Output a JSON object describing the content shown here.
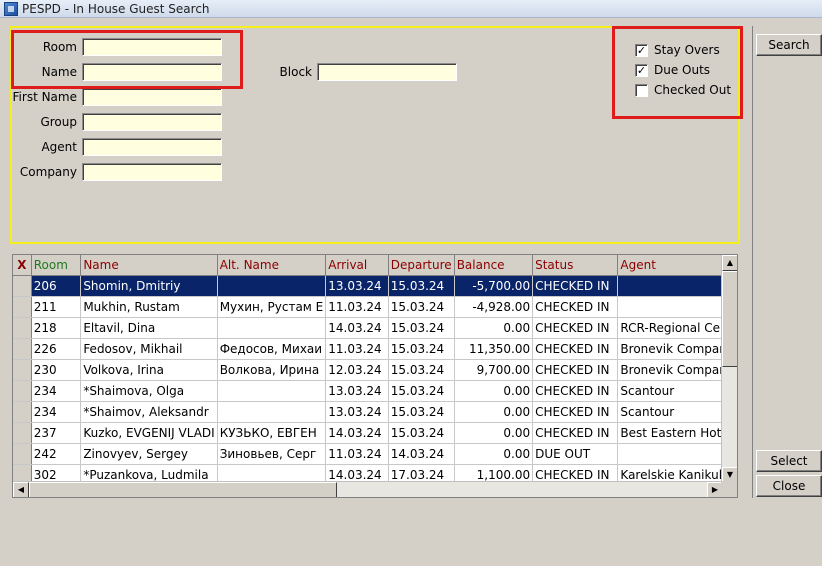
{
  "window": {
    "title": "PESPD - In House Guest Search"
  },
  "form": {
    "room_label": "Room",
    "name_label": "Name",
    "first_name_label": "First Name",
    "group_label": "Group",
    "agent_label": "Agent",
    "company_label": "Company",
    "block_label": "Block",
    "room_value": "",
    "name_value": "",
    "first_name_value": "",
    "group_value": "",
    "agent_value": "",
    "company_value": "",
    "block_value": ""
  },
  "filters": {
    "stay_overs": {
      "label": "Stay Overs",
      "checked": true
    },
    "due_outs": {
      "label": "Due Outs",
      "checked": true
    },
    "checked_out": {
      "label": "Checked Out",
      "checked": false
    }
  },
  "buttons": {
    "search": "Search",
    "select": "Select",
    "close": "Close"
  },
  "colors": {
    "highlight_box": "#e01b1b",
    "panel_border": "#f2f018",
    "selected_row": "#0a246a",
    "field_bg": "#ffffe0"
  },
  "grid": {
    "columns": [
      "X",
      "Room",
      "Name",
      "Alt. Name",
      "Arrival",
      "Departure",
      "Balance",
      "Status",
      "Agent"
    ],
    "rows": [
      [
        "",
        "206",
        "Shomin, Dmitriy",
        "",
        "13.03.24",
        "15.03.24",
        "-5,700.00",
        "CHECKED IN",
        ""
      ],
      [
        "",
        "211",
        "Mukhin, Rustam",
        "Мухин, Рустам Е",
        "11.03.24",
        "15.03.24",
        "-4,928.00",
        "CHECKED IN",
        ""
      ],
      [
        "",
        "218",
        "Eltavil, Dina",
        "",
        "14.03.24",
        "15.03.24",
        "0.00",
        "CHECKED IN",
        "RCR-Regional Cen"
      ],
      [
        "",
        "226",
        "Fedosov, Mikhail",
        "Федосов, Михаи",
        "11.03.24",
        "15.03.24",
        "11,350.00",
        "CHECKED IN",
        "Bronevik Company"
      ],
      [
        "",
        "230",
        "Volkova, Irina",
        "Волкова, Ирина",
        "12.03.24",
        "15.03.24",
        "9,700.00",
        "CHECKED IN",
        "Bronevik Company"
      ],
      [
        "",
        "234",
        "*Shaimova, Olga",
        "",
        "13.03.24",
        "15.03.24",
        "0.00",
        "CHECKED IN",
        "Scantour"
      ],
      [
        "",
        "234",
        "*Shaimov, Aleksandr",
        "",
        "13.03.24",
        "15.03.24",
        "0.00",
        "CHECKED IN",
        "Scantour"
      ],
      [
        "",
        "237",
        "Kuzko, EVGENIJ VLADI",
        "КУЗЬКО, ЕВГЕН",
        "14.03.24",
        "15.03.24",
        "0.00",
        "CHECKED IN",
        "Best Eastern Hotel"
      ],
      [
        "",
        "242",
        "Zinovyev, Sergey",
        "Зиновьев, Серг",
        "11.03.24",
        "14.03.24",
        "0.00",
        "DUE OUT",
        ""
      ],
      [
        "",
        "302",
        "*Puzankova, Ludmila",
        "",
        "14.03.24",
        "17.03.24",
        "1,100.00",
        "CHECKED IN",
        "Karelskie Kanikuly"
      ]
    ],
    "selected_row": 0
  }
}
